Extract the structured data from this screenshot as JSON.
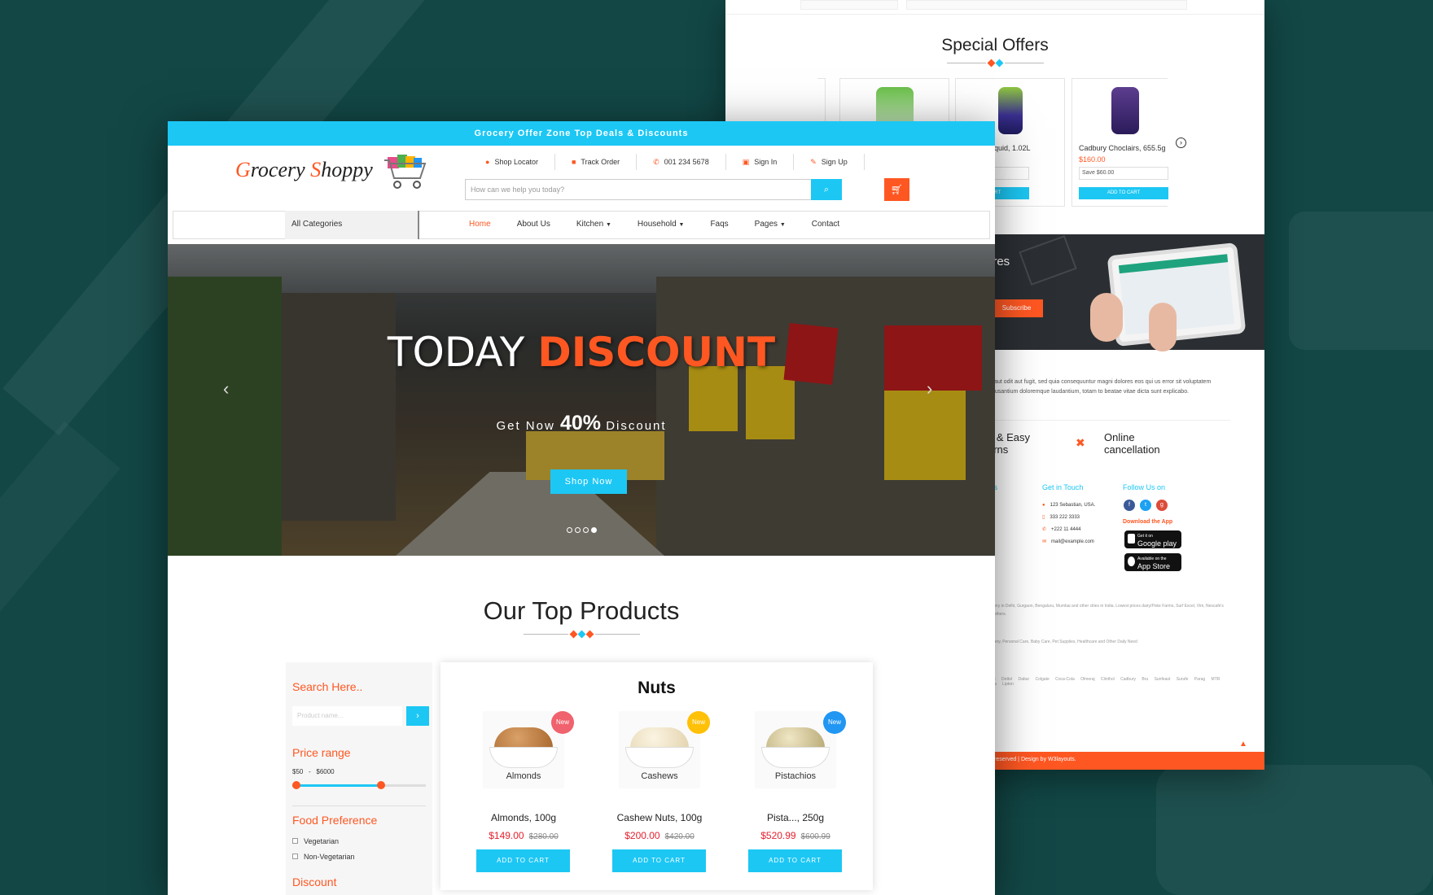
{
  "colors": {
    "accent": "#1cc7f4",
    "brand_orange": "#ff5722",
    "background": "#124746",
    "price_red": "#e5202e"
  },
  "front": {
    "topbar": "Grocery Offer Zone Top Deals & Discounts",
    "logo": {
      "first": "G",
      "rest1": "rocery ",
      "second": "S",
      "rest2": "hoppy"
    },
    "toplinks": [
      {
        "label": "Shop Locator",
        "icon": "map-marker-icon"
      },
      {
        "label": "Track Order",
        "icon": "truck-icon"
      },
      {
        "label": "001 234 5678",
        "icon": "phone-icon"
      },
      {
        "label": "Sign In",
        "icon": "lock-icon"
      },
      {
        "label": "Sign Up",
        "icon": "edit-icon"
      }
    ],
    "search_placeholder": "How can we help you today?",
    "category_select": "All Categories",
    "nav": [
      "Home",
      "About Us",
      "Kitchen",
      "Household",
      "Faqs",
      "Pages",
      "Contact"
    ],
    "hero": {
      "title_white": "TODAY",
      "title_orange": "DISCOUNT",
      "sub_pre": "Get Now",
      "sub_pct": "40%",
      "sub_post": "Discount",
      "button": "Shop Now",
      "slide_count": 4,
      "active_slide": 4
    },
    "section_title": "Our Top Products",
    "sidebar": {
      "search_heading": "Search Here..",
      "search_placeholder": "Product name...",
      "price_heading": "Price range",
      "price_min": "$50",
      "price_sep": "-",
      "price_max": "$6000",
      "food_heading": "Food Preference",
      "veg": "Vegetarian",
      "nonveg": "Non-Vegetarian",
      "discount_heading": "Discount"
    },
    "nuts": {
      "title": "Nuts",
      "products": [
        {
          "image_label": "Almonds",
          "badge": "New",
          "badge_color": "#f0626d",
          "name": "Almonds, 100g",
          "price": "$149.00",
          "old_price": "$280.00",
          "button": "ADD TO CART"
        },
        {
          "image_label": "Cashews",
          "badge": "New",
          "badge_color": "#ffc107",
          "name": "Cashew Nuts, 100g",
          "price": "$200.00",
          "old_price": "$420.00",
          "button": "ADD TO CART"
        },
        {
          "image_label": "Pistachios",
          "badge": "New",
          "badge_color": "#2196f3",
          "name": "Pista..., 250g",
          "price": "$520.99",
          "old_price": "$600.99",
          "button": "ADD TO CART"
        }
      ]
    }
  },
  "back": {
    "special_offers": "Special Offers",
    "offers": [
      {
        "name": "",
        "price": "",
        "save": "",
        "button": ""
      },
      {
        "name": "Liquid, 1.02L",
        "price": "",
        "save": "",
        "button": "ADD TO CART"
      },
      {
        "name": "Cadbury Choclairs, 655.5g",
        "price": "$160.00",
        "save": "Save $60.00",
        "button": "ADD TO CART"
      }
    ],
    "dark_heading": "ores",
    "subscribe": "Subscribe",
    "paragraph": "tur aut odit aut fugit, sed quia consequuntur magni dolores eos qui us error sit voluptatem accusantium doloremque laudantium, totam to beatae vitae dicta sunt explicabo.",
    "feature1": "e & Easy\nurns",
    "feature2": "Online\ncancellation",
    "footer_heads": [
      "nks",
      "Get in Touch",
      "Follow Us on"
    ],
    "contact": [
      "123 Sebastian, USA.",
      "333 222 3333",
      "+222 11 4444",
      "mail@example.com"
    ],
    "download": "Download the App",
    "google": {
      "small": "Get it on",
      "big": "Google play"
    },
    "apple": {
      "small": "Available on the",
      "big": "App Store"
    },
    "gray1": "delivery in Delhi, Gurgaon, Bengaluru, Mumbai and other cities in India. Lowest prices dairy/Poke Farms, Surf Excel, Vim, Nescafe's and others.",
    "gray2": "Grocery, Personal Care, Baby Care, Pet Supplies, Healthcare and Other Daily Need",
    "gray3": "Dove Dettol Dabur Colgate Coca-Cola Olmeraj Clinthol Cadbury Bru Sunfeast Surufe Parag MTR Nivea Lipton",
    "footer_bar": "reserved | Design by W3layouts."
  }
}
